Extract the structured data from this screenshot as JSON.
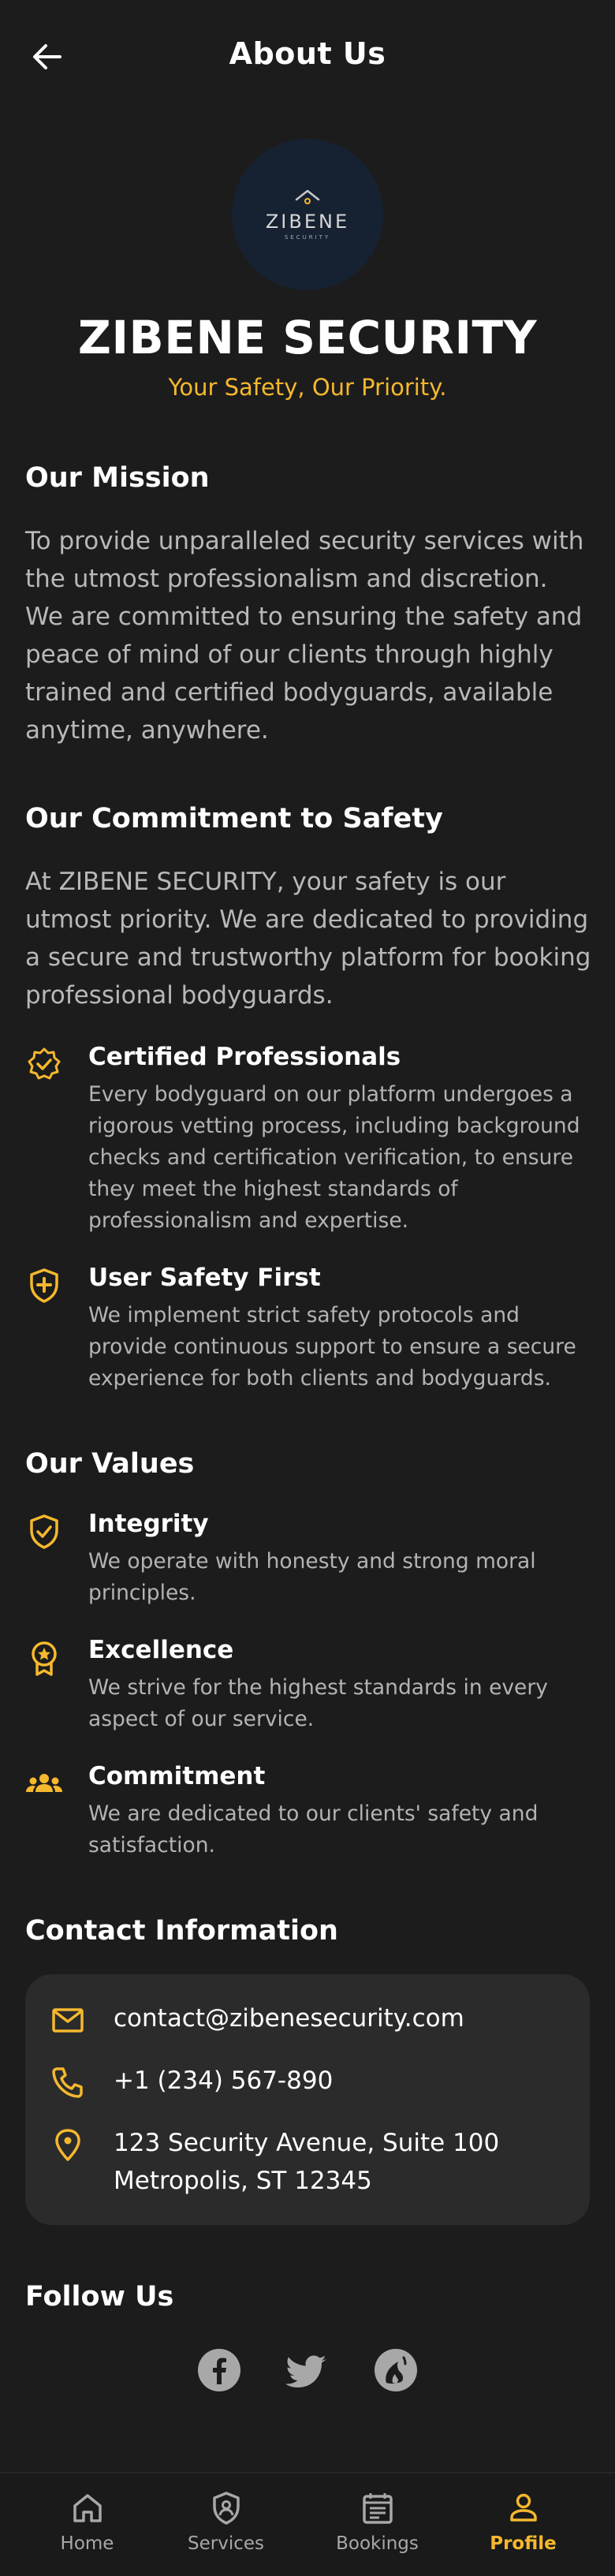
{
  "header": {
    "title": "About Us"
  },
  "logo": {
    "text": "ZIBENE",
    "subtext": "SECURITY"
  },
  "brand": {
    "name": "ZIBENE SECURITY",
    "tagline": "Your Safety, Our Priority."
  },
  "mission": {
    "title": "Our Mission",
    "body": "To provide unparalleled security services with the utmost professionalism and discretion. We are committed to ensuring the safety and peace of mind of our clients through highly trained and certified bodyguards, available anytime, anywhere."
  },
  "commitment": {
    "title": "Our Commitment to Safety",
    "body": "At ZIBENE SECURITY, your safety is our utmost priority. We are dedicated to providing a secure and trustworthy platform for booking professional bodyguards.",
    "items": [
      {
        "icon": "verified-badge-icon",
        "title": "Certified Professionals",
        "desc": "Every bodyguard on our platform undergoes a rigorous vetting process, including background checks and certification verification, to ensure they meet the highest standards of professionalism and expertise."
      },
      {
        "icon": "shield-plus-icon",
        "title": "User Safety First",
        "desc": "We implement strict safety protocols and provide continuous support to ensure a secure experience for both clients and bodyguards."
      }
    ]
  },
  "values": {
    "title": "Our Values",
    "items": [
      {
        "icon": "shield-check-icon",
        "title": "Integrity",
        "desc": "We operate with honesty and strong moral principles."
      },
      {
        "icon": "award-icon",
        "title": "Excellence",
        "desc": "We strive for the highest standards in every aspect of our service."
      },
      {
        "icon": "group-icon",
        "title": "Commitment",
        "desc": "We are dedicated to our clients' safety and satisfaction."
      }
    ]
  },
  "contact": {
    "title": "Contact Information",
    "email": "contact@zibenesecurity.com",
    "phone": "+1 (234) 567-890",
    "address_line1": "123 Security Avenue, Suite 100",
    "address_line2": "Metropolis, ST 12345"
  },
  "follow": {
    "title": "Follow Us",
    "networks": [
      "facebook-icon",
      "twitter-icon",
      "instagram-icon"
    ]
  },
  "nav": {
    "items": [
      {
        "label": "Home",
        "icon": "home-icon"
      },
      {
        "label": "Services",
        "icon": "shield-user-icon"
      },
      {
        "label": "Bookings",
        "icon": "calendar-icon"
      },
      {
        "label": "Profile",
        "icon": "person-icon"
      }
    ],
    "active": "Profile"
  },
  "colors": {
    "accent": "#f5b82e",
    "background": "#1c1c1c",
    "card": "#2b2b2b",
    "muted_text": "#b8b8b8"
  }
}
